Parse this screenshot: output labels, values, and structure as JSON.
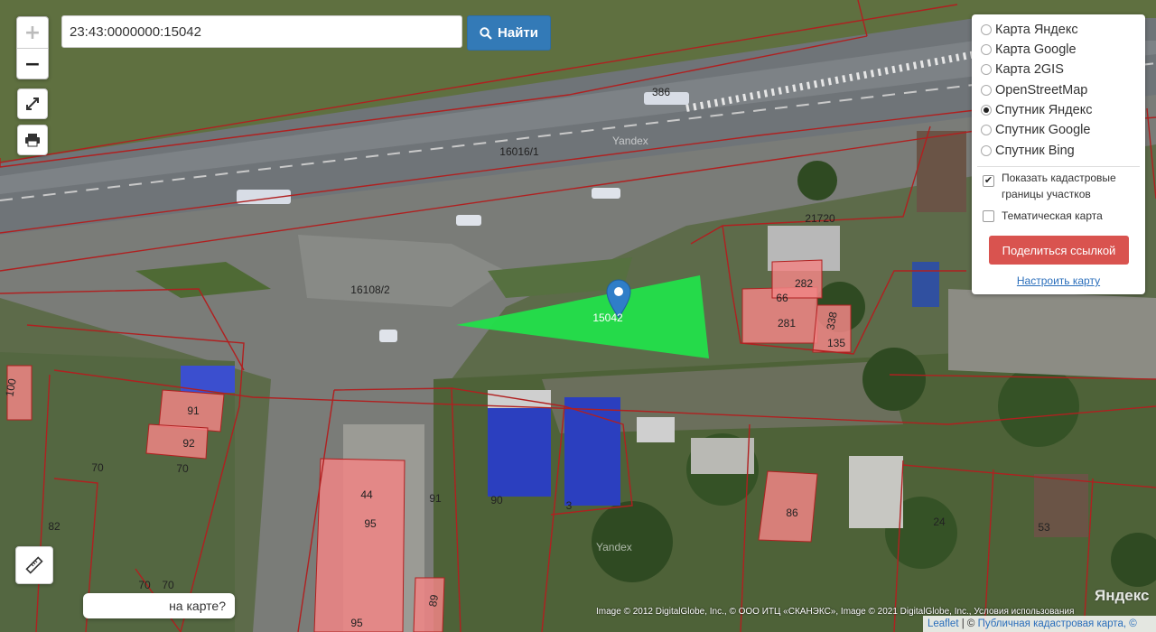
{
  "search": {
    "value": "23:43:0000000:15042",
    "button_label": "Найти"
  },
  "zoom": {
    "in_label": "+",
    "out_label": "−"
  },
  "layers": {
    "items": [
      {
        "label": "Карта Яндекс",
        "selected": false
      },
      {
        "label": "Карта Google",
        "selected": false
      },
      {
        "label": "Карта 2GIS",
        "selected": false
      },
      {
        "label": "OpenStreetMap",
        "selected": false
      },
      {
        "label": "Спутник Яндекс",
        "selected": true
      },
      {
        "label": "Спутник Google",
        "selected": false
      },
      {
        "label": "Спутник Bing",
        "selected": false
      }
    ],
    "show_cadastral_label": "Показать кадастровые границы участков",
    "show_cadastral_checked": true,
    "thematic_label": "Тематическая карта",
    "thematic_checked": false,
    "share_label": "Поделиться ссылкой",
    "configure_label": "Настроить карту"
  },
  "map": {
    "parcel_labels": [
      "386",
      "16016/1",
      "16108/2",
      "21720",
      "15042",
      "282",
      "66",
      "281",
      "338",
      "135",
      "100",
      "91",
      "92",
      "70",
      "70",
      "82",
      "70",
      "70",
      "44",
      "95",
      "91",
      "90",
      "3",
      "86",
      "24",
      "53",
      "89",
      "95"
    ],
    "watermarks": [
      "Yandex",
      "Yandex"
    ],
    "colors": {
      "selected_parcel": "#22e04a",
      "parcel_fill": "#f08080",
      "boundary": "#b02020",
      "marker": "#2f7ec8"
    }
  },
  "tooltip": {
    "text": "на карте?"
  },
  "attribution": {
    "imagery": "Image © 2012 DigitalGlobe, Inc., © ООО ИТЦ «СКАНЭКС», Image © 2021 DigitalGlobe, Inc., Условия использования",
    "logo": "Яндекс",
    "leaflet": "Leaflet",
    "separator": " | © ",
    "kadastr": "Публичная кадастровая карта, ©"
  }
}
